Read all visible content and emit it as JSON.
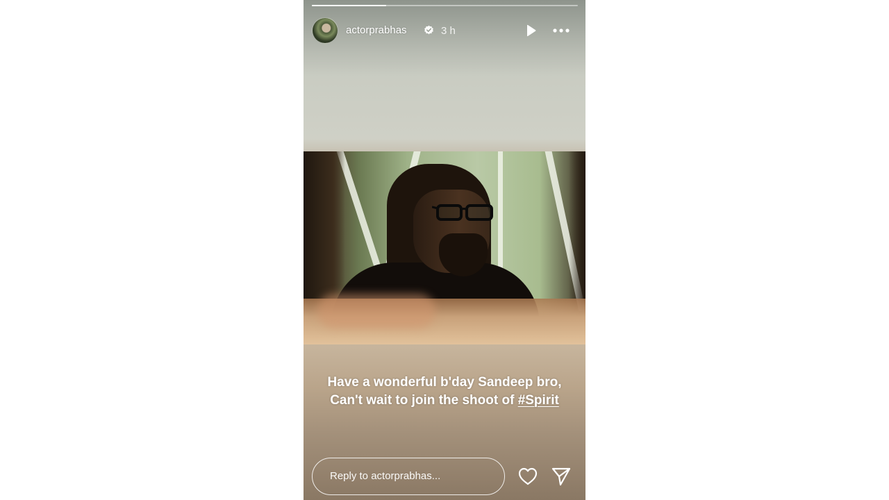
{
  "story": {
    "progress": 0.28,
    "account": {
      "username": "actorprabhas",
      "verified": true,
      "time_ago": "3 h",
      "avatar_icon": "profile-avatar"
    },
    "controls": {
      "play_icon": "play-icon",
      "more_icon": "more-options-icon"
    },
    "caption": {
      "line1": "Have a wonderful b'day Sandeep bro,",
      "line2_prefix": "Can't wait to join the shoot of ",
      "hashtag": "#Spirit"
    },
    "reply": {
      "placeholder": "Reply to actorprabhas..."
    },
    "actions": {
      "like_icon": "heart-icon",
      "share_icon": "send-icon"
    }
  }
}
